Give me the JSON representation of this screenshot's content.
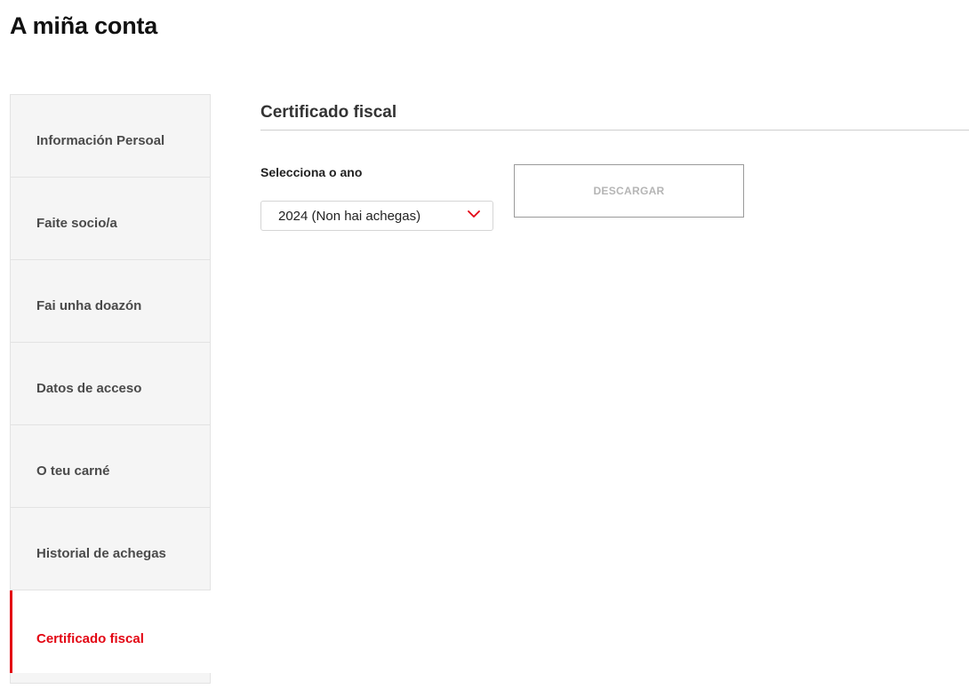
{
  "page": {
    "title": "A miña conta"
  },
  "sidebar": {
    "items": [
      {
        "label": "Información Persoal",
        "active": false
      },
      {
        "label": "Faite socio/a",
        "active": false
      },
      {
        "label": "Fai unha doazón",
        "active": false
      },
      {
        "label": "Datos de acceso",
        "active": false
      },
      {
        "label": "O teu carné",
        "active": false
      },
      {
        "label": "Historial de achegas",
        "active": false
      },
      {
        "label": "Certificado fiscal",
        "active": true
      }
    ]
  },
  "main": {
    "section_title": "Certificado fiscal",
    "year_label": "Selecciona o ano",
    "year_select": {
      "selected": "2024 (Non hai achegas)",
      "icon": "chevron-down-icon"
    },
    "download_button": {
      "label": "DESCARGAR",
      "disabled": true
    }
  },
  "colors": {
    "accent": "#e30613",
    "sidebar_bg": "#f5f5f5",
    "disabled_text": "#b5b5b5"
  }
}
